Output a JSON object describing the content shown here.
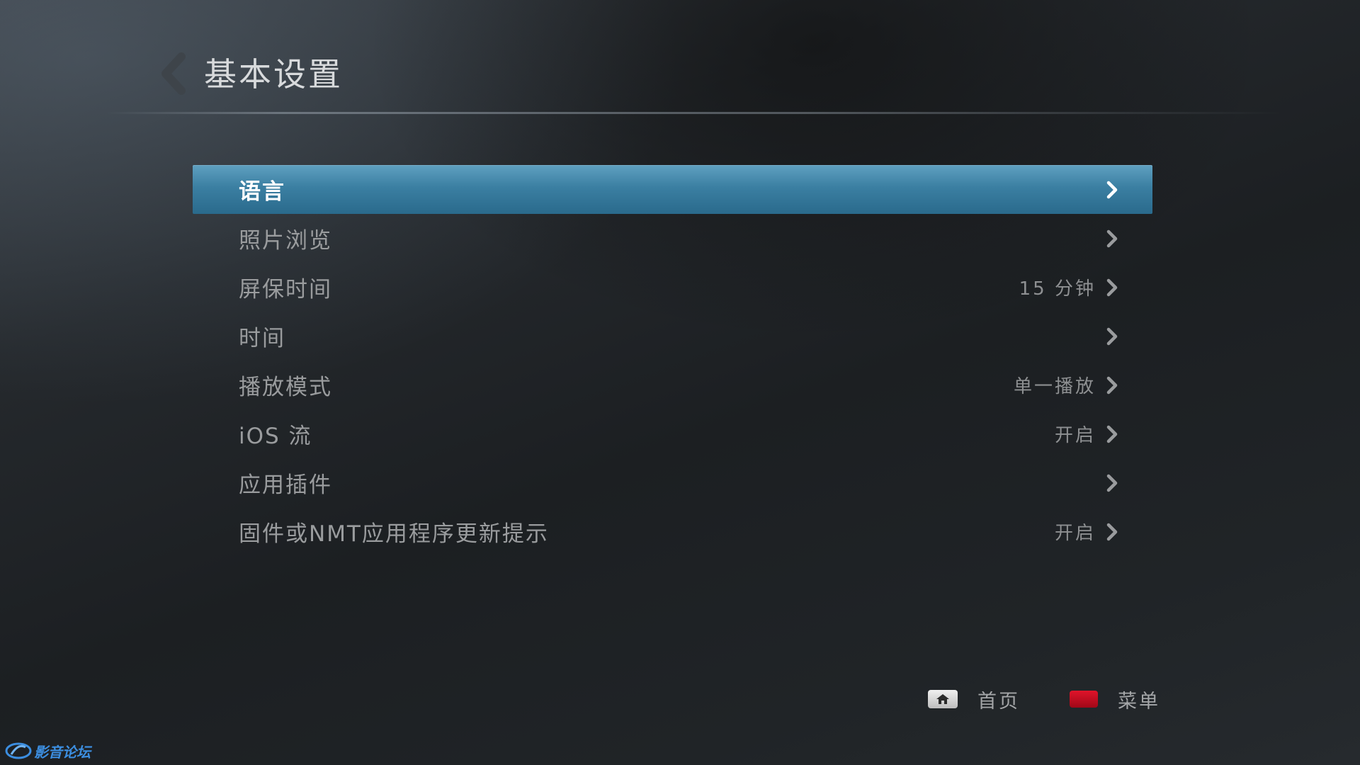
{
  "header": {
    "title": "基本设置"
  },
  "menu": {
    "items": [
      {
        "label": "语言",
        "value": "",
        "selected": true
      },
      {
        "label": "照片浏览",
        "value": ""
      },
      {
        "label": "屏保时间",
        "value": "15 分钟"
      },
      {
        "label": "时间",
        "value": ""
      },
      {
        "label": "播放模式",
        "value": "单一播放"
      },
      {
        "label": "iOS 流",
        "value": "开启"
      },
      {
        "label": "应用插件",
        "value": ""
      },
      {
        "label": "固件或NMT应用程序更新提示",
        "value": "开启"
      }
    ]
  },
  "footer": {
    "home_label": "首页",
    "menu_label": "菜单"
  },
  "watermark": {
    "text": "影音论坛"
  },
  "colors": {
    "selection": "#3b7fa2",
    "red_key": "#d0102a",
    "text": "#9a9c9e"
  },
  "icons": {
    "back": "back-chevron-icon",
    "item_arrow": "chevron-right-icon",
    "home_key": "home-icon",
    "red_key": "red-button-icon"
  }
}
